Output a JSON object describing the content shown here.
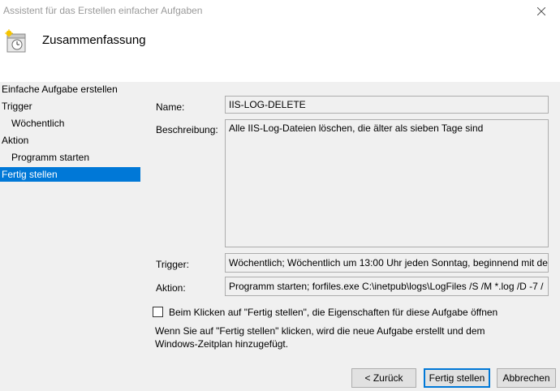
{
  "window": {
    "title": "Assistent für das Erstellen einfacher Aufgaben"
  },
  "header": {
    "title": "Zusammenfassung",
    "icon": "task-scheduler-icon"
  },
  "sidebar": {
    "items": [
      {
        "label": "Einfache Aufgabe erstellen",
        "active": false
      },
      {
        "label": "Trigger",
        "active": false
      },
      {
        "label": "Wöchentlich",
        "active": false
      },
      {
        "label": "Aktion",
        "active": false
      },
      {
        "label": "Programm starten",
        "active": false
      },
      {
        "label": "Fertig stellen",
        "active": true
      }
    ]
  },
  "summary": {
    "name_label": "Name:",
    "name_value": "IIS-LOG-DELETE",
    "description_label": "Beschreibung:",
    "description_value": "Alle IIS-Log-Dateien löschen, die älter als sieben Tage sind",
    "trigger_label": "Trigger:",
    "trigger_value": "Wöchentlich; Wöchentlich um 13:00 Uhr jeden Sonntag, beginnend mit de",
    "action_label": "Aktion:",
    "action_value": "Programm starten; forfiles.exe C:\\inetpub\\logs\\LogFiles /S /M *.log /D -7 /"
  },
  "open_properties": {
    "label": "Beim Klicken auf \"Fertig stellen\", die Eigenschaften für diese Aufgabe öffnen",
    "checked": false
  },
  "info": {
    "line1": "Wenn Sie auf \"Fertig stellen\" klicken, wird die neue Aufgabe erstellt und dem",
    "line2": "Windows-Zeitplan hinzugefügt."
  },
  "buttons": {
    "back": "< Zurück",
    "finish": "Fertig stellen",
    "cancel": "Abbrechen"
  },
  "colors": {
    "accent": "#0078d7",
    "panel": "#f0f0f0"
  }
}
